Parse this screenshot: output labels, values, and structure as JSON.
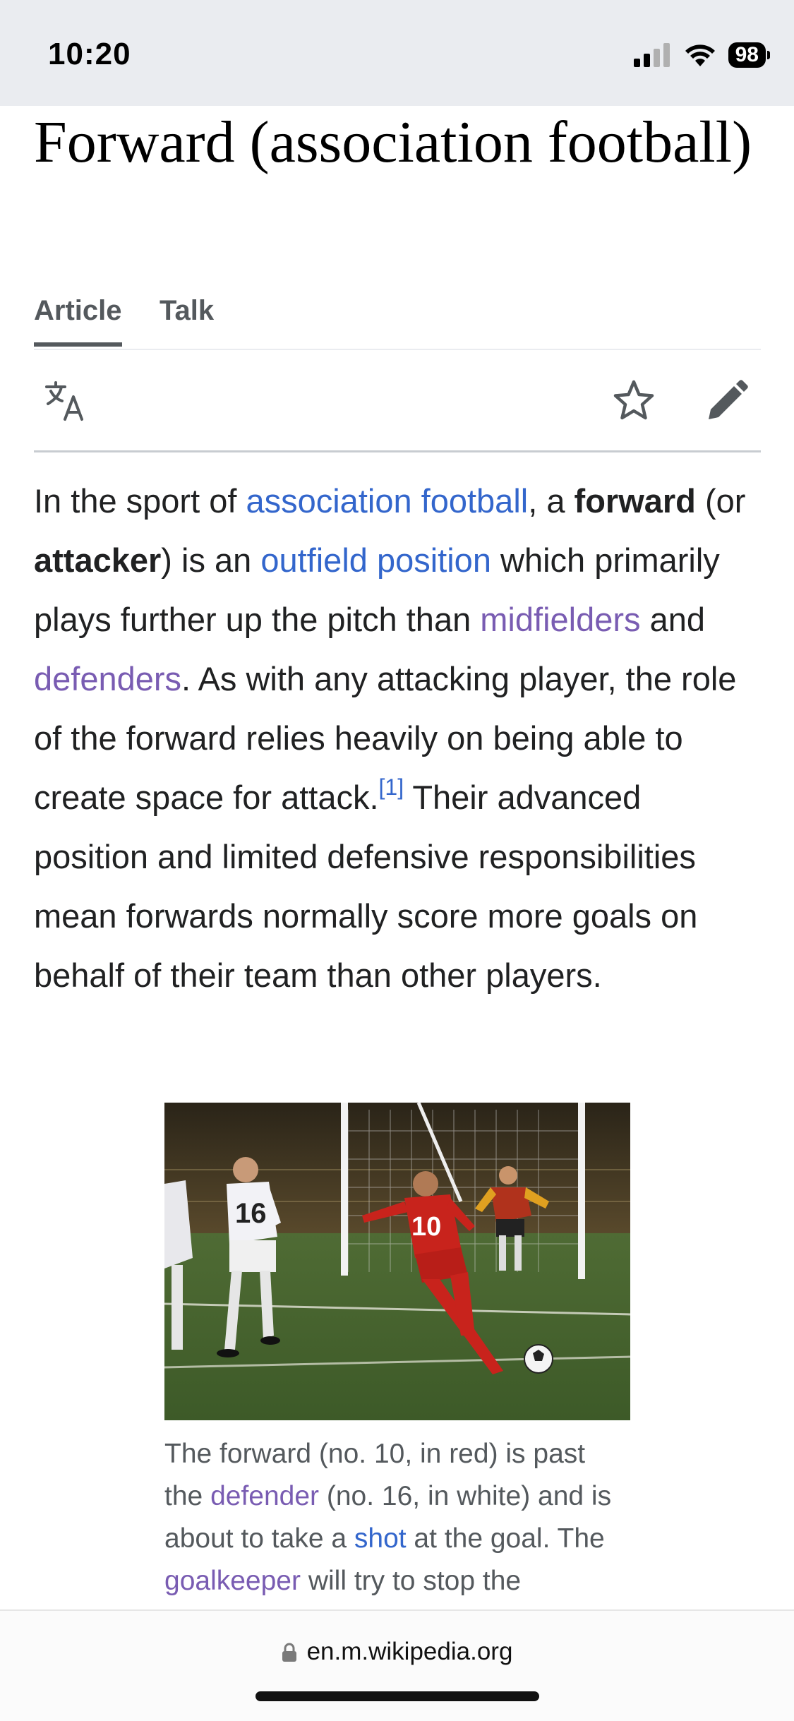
{
  "status_bar": {
    "time": "10:20",
    "battery": "98"
  },
  "article": {
    "title": "Forward (association football)",
    "tabs": [
      {
        "label": "Article",
        "active": true
      },
      {
        "label": "Talk",
        "active": false
      }
    ],
    "toolbar_icons": [
      "translate-icon",
      "star-icon",
      "edit-icon"
    ],
    "lead": {
      "t1": "In the sport of ",
      "link_association_football": "association football",
      "t2": ", a ",
      "bold_forward": "forward",
      "t3": " (or ",
      "bold_attacker": "attacker",
      "t4": ") is an ",
      "link_outfield_position": "outfield position",
      "t5": " which primarily plays further up the pitch than ",
      "link_midfielders": "midfielders",
      "t6": " and ",
      "link_defenders": "defenders",
      "t7": ". As with any attacking player, the role of the forward relies heavily on being able to create space for attack.",
      "ref": "[1]",
      "t8": " Their advanced position and limited defensive responsibilities mean forwards normally score more goals on behalf of their team than other players."
    }
  },
  "figure": {
    "caption": {
      "c1": "The forward (no. 10, in red) is past the ",
      "link_defender": "defender",
      "c2": " (no. 16, in white) and is about to take a ",
      "link_shot": "shot",
      "c3": " at the goal. The ",
      "link_goalkeeper": "goalkeeper",
      "c4": " will try to stop the"
    },
    "photo_jerseys": {
      "forward_number": "10",
      "defender_number": "16"
    }
  },
  "browser": {
    "url": "en.m.wikipedia.org"
  },
  "colors": {
    "link": "#3366cc",
    "visited_link": "#795cb2",
    "text": "#202122",
    "status_bar_bg": "#eaecf0"
  }
}
